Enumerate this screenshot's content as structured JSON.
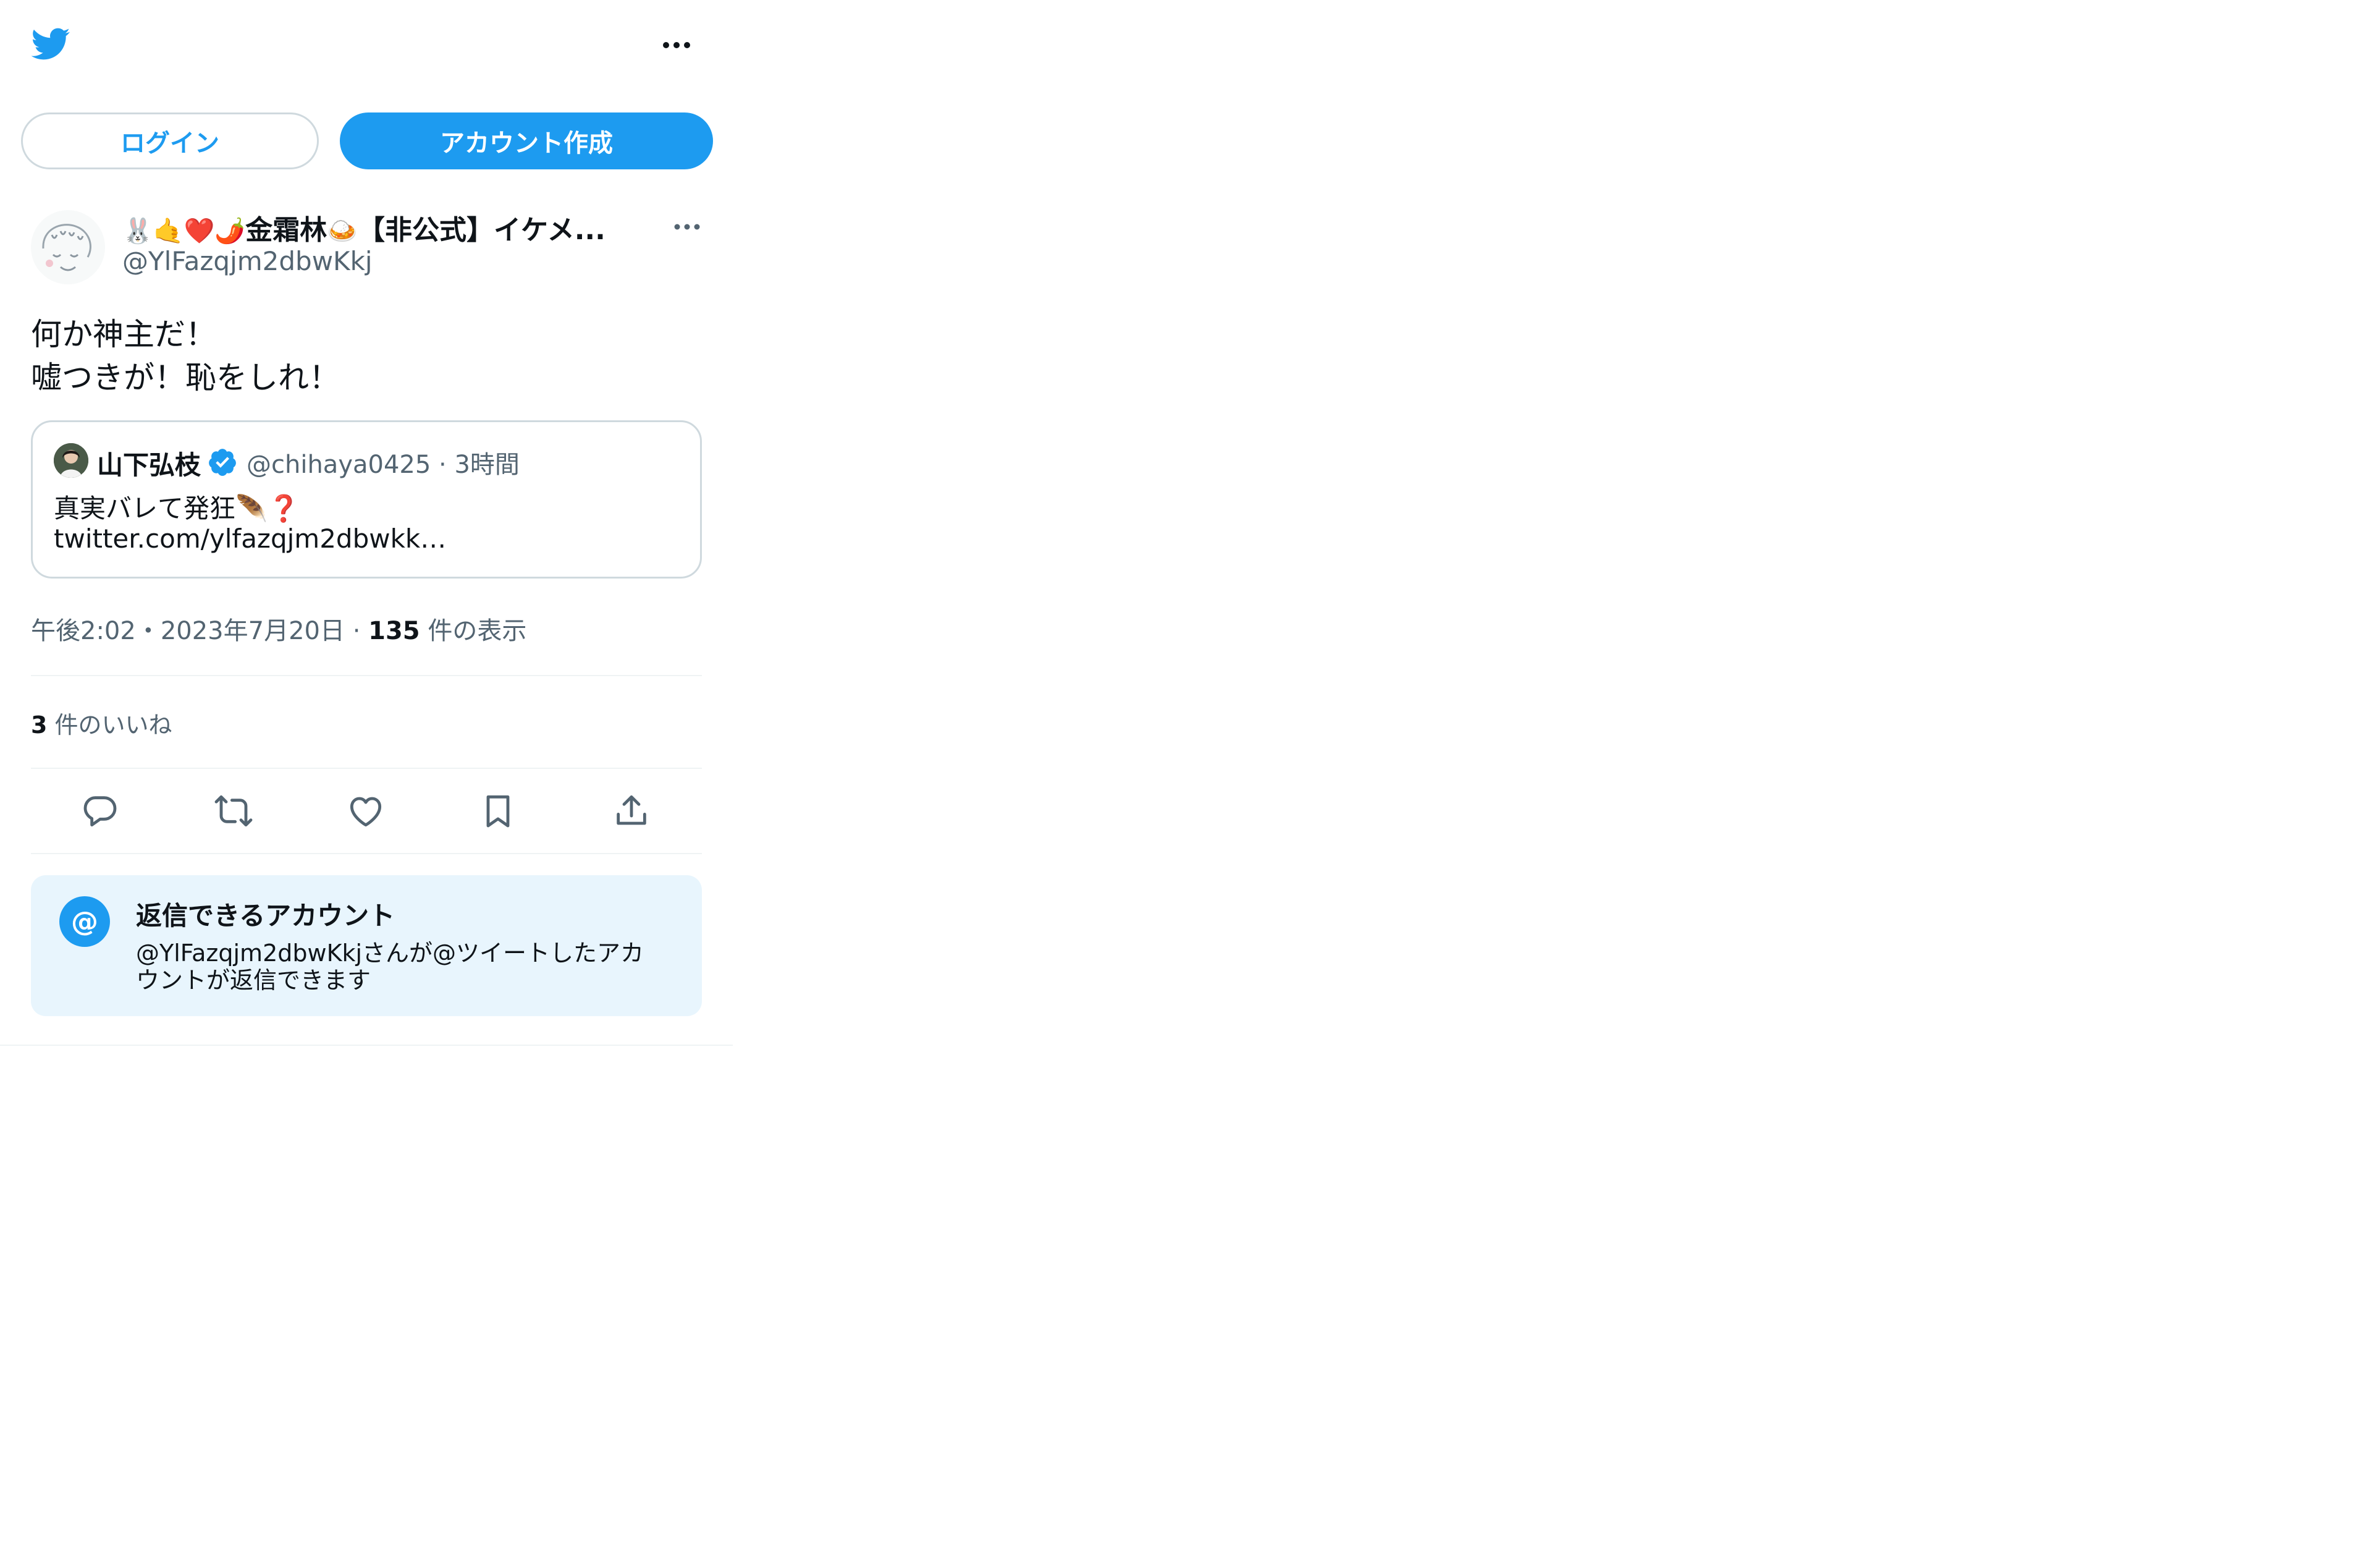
{
  "header": {
    "logo_icon": "twitter-bird-icon",
    "more_icon": "more-horizontal-icon",
    "login_label": "ログイン",
    "signup_label": "アカウント作成"
  },
  "tweet": {
    "display_name_emojis": "🐰🤙❤️🌶️",
    "display_name_text": "金霜林",
    "display_name_emoji2": "🍛",
    "display_name_suffix": "【非公式】イケメ...",
    "handle": "@YlFazqjm2dbwKkj",
    "text": "何か神主だ！\n嘘つきが！恥をしれ！",
    "timestamp": "午後2:02・2023年7月20日",
    "views_count": "135",
    "views_label": "件の表示",
    "likes_count": "3",
    "likes_label": "件のいいね"
  },
  "quote": {
    "name": "山下弘枝",
    "handle_time": "@chihaya0425 · 3時間",
    "text1": "真実バレて発狂🪶❓",
    "text2": "twitter.com/ylfazqjm2dbwkk…"
  },
  "actions": [
    "reply-icon",
    "retweet-icon",
    "like-icon",
    "bookmark-icon",
    "share-icon"
  ],
  "reply_restriction": {
    "icon": "@",
    "title": "返信できるアカウント",
    "description": "@YlFazqjm2dbwKkjさんが@ツイートしたアカウントが返信できます"
  },
  "colors": {
    "brand": "#1d9bf0",
    "text": "#0f1419",
    "muted": "#536471",
    "border": "#cfd9de"
  }
}
